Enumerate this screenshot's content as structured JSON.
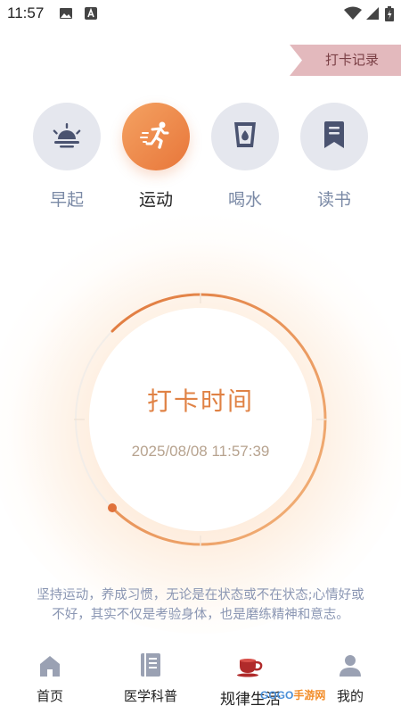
{
  "status_bar": {
    "time": "11:57"
  },
  "record_button": {
    "label": "打卡记录"
  },
  "categories": [
    {
      "label": "早起",
      "icon": "sunrise-icon",
      "active": false
    },
    {
      "label": "运动",
      "icon": "running-icon",
      "active": true
    },
    {
      "label": "喝水",
      "icon": "water-cup-icon",
      "active": false
    },
    {
      "label": "读书",
      "icon": "bookmark-icon",
      "active": false
    }
  ],
  "punch": {
    "title": "打卡时间",
    "time": "2025/08/08 11:57:39",
    "progress": 0.75
  },
  "quote": "坚持运动，养成习惯，无论是在状态或不在状态;心情好或不好，其实不仅是考验身体，也是磨练精神和意志。",
  "bottom_nav": [
    {
      "label": "首页",
      "icon": "home-icon"
    },
    {
      "label": "医学科普",
      "icon": "book-icon"
    },
    {
      "label": "规律生活",
      "icon": "tea-cup-icon",
      "active": true
    },
    {
      "label": "我的",
      "icon": "user-icon"
    }
  ],
  "watermark": {
    "left": "GOGO",
    "right": "手游网"
  },
  "colors": {
    "accent": "#e8763a",
    "ribbon": "#e3b9bd",
    "inactive_circle": "#e5e7ee",
    "inactive_label": "#7b8aa6",
    "nav_active_icon": "#b02a2a"
  }
}
